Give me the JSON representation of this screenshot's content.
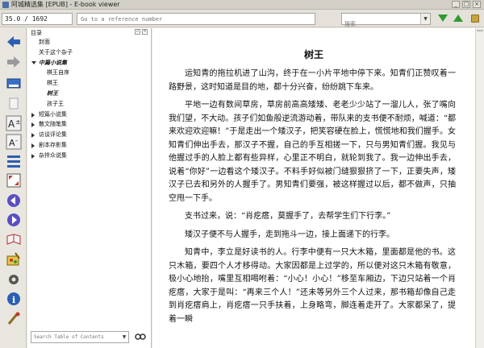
{
  "window": {
    "title": "阿城精选集 [EPUB] - E-book viewer"
  },
  "toolbar": {
    "position_value": "35.0 / 1692",
    "reference_placeholder": "Go to a reference number",
    "search_placeholder": "搜索"
  },
  "toc": {
    "header": "目录",
    "items": [
      {
        "label": "封面",
        "indent": 1,
        "expander": "none",
        "style": "normal"
      },
      {
        "label": "关于这个杂子",
        "indent": 1,
        "expander": "none",
        "style": "normal"
      },
      {
        "label": "中篇小说集",
        "indent": 1,
        "expander": "open",
        "style": "italic"
      },
      {
        "label": "棋王自序",
        "indent": 2,
        "expander": "none",
        "style": "normal"
      },
      {
        "label": "棋王",
        "indent": 2,
        "expander": "none",
        "style": "normal"
      },
      {
        "label": "树王",
        "indent": 2,
        "expander": "none",
        "style": "italic"
      },
      {
        "label": "孩子王",
        "indent": 2,
        "expander": "none",
        "style": "normal"
      },
      {
        "label": "短篇小说集",
        "indent": 1,
        "expander": "closed",
        "style": "normal"
      },
      {
        "label": "散文随笔集",
        "indent": 1,
        "expander": "closed",
        "style": "normal"
      },
      {
        "label": "访谈评论集",
        "indent": 1,
        "expander": "closed",
        "style": "normal"
      },
      {
        "label": "剧本存影集",
        "indent": 1,
        "expander": "closed",
        "style": "normal"
      },
      {
        "label": "杂拌众说集",
        "indent": 1,
        "expander": "closed",
        "style": "normal"
      }
    ],
    "search_placeholder": "Search Table of Contents"
  },
  "content": {
    "title": "树王",
    "paragraphs": [
      "运知青的拖拉机进了山沟，终于在一小片平地中停下来。知青们正赞叹着一路野景，这时知道是目的地，都十分兴奋，纷纷跳下车来。",
      "平地一边有数间草房，草房前高高矮矮、老老少少站了一溜儿人，张了嘴向我们望，不大动。孩子们如鱼般逆流游动着，带队来的支书便不耐烦，喊道：“都来欢迎欢迎嘛！”于是走出一个矮汉子，把笑容硬在脸上，慌慌地和我们握手。女知青们伸出手去，那汉子不握，自己的手互相搓一下，只与男知青们握。我见与他握过手的人脸上都有些异样，心里正不明白，就轮到我了。我一边伸出手去，说着“你好”一边看这个矮汉子。不料手好似被门缝狠狠挤了一下，正要失声，矮汉子已去和另外的人握手了。男知青们要强，被这样握过以后，都不做声，只抽空甩一下手。",
      "支书过来，说：“肖疙瘩，莫握手了，去帮学生们下行李。”",
      "矮汉子便不与人握手，走到拖斗一边，接上面递下的行李。",
      "知青中，李立是好读书的人。行李中便有一只大木箱，里面都是他的书。这只木箱，要四个人才移得动。大家因都是上过学的，所以便对这只木箱有敬意，极小心地抬，嘴里互相喝咐着：“小心！小心！”移至车厢边，下边只站着一个肖疙瘩，大家于是叫：“再来三个人！”还未等另外三个人过来，那书箱却像自己走到肖疙瘩肩上，肖疙瘩一只手扶着，上身略弯，脚连着走开了。大家都呆了，提着一瞬"
    ]
  }
}
